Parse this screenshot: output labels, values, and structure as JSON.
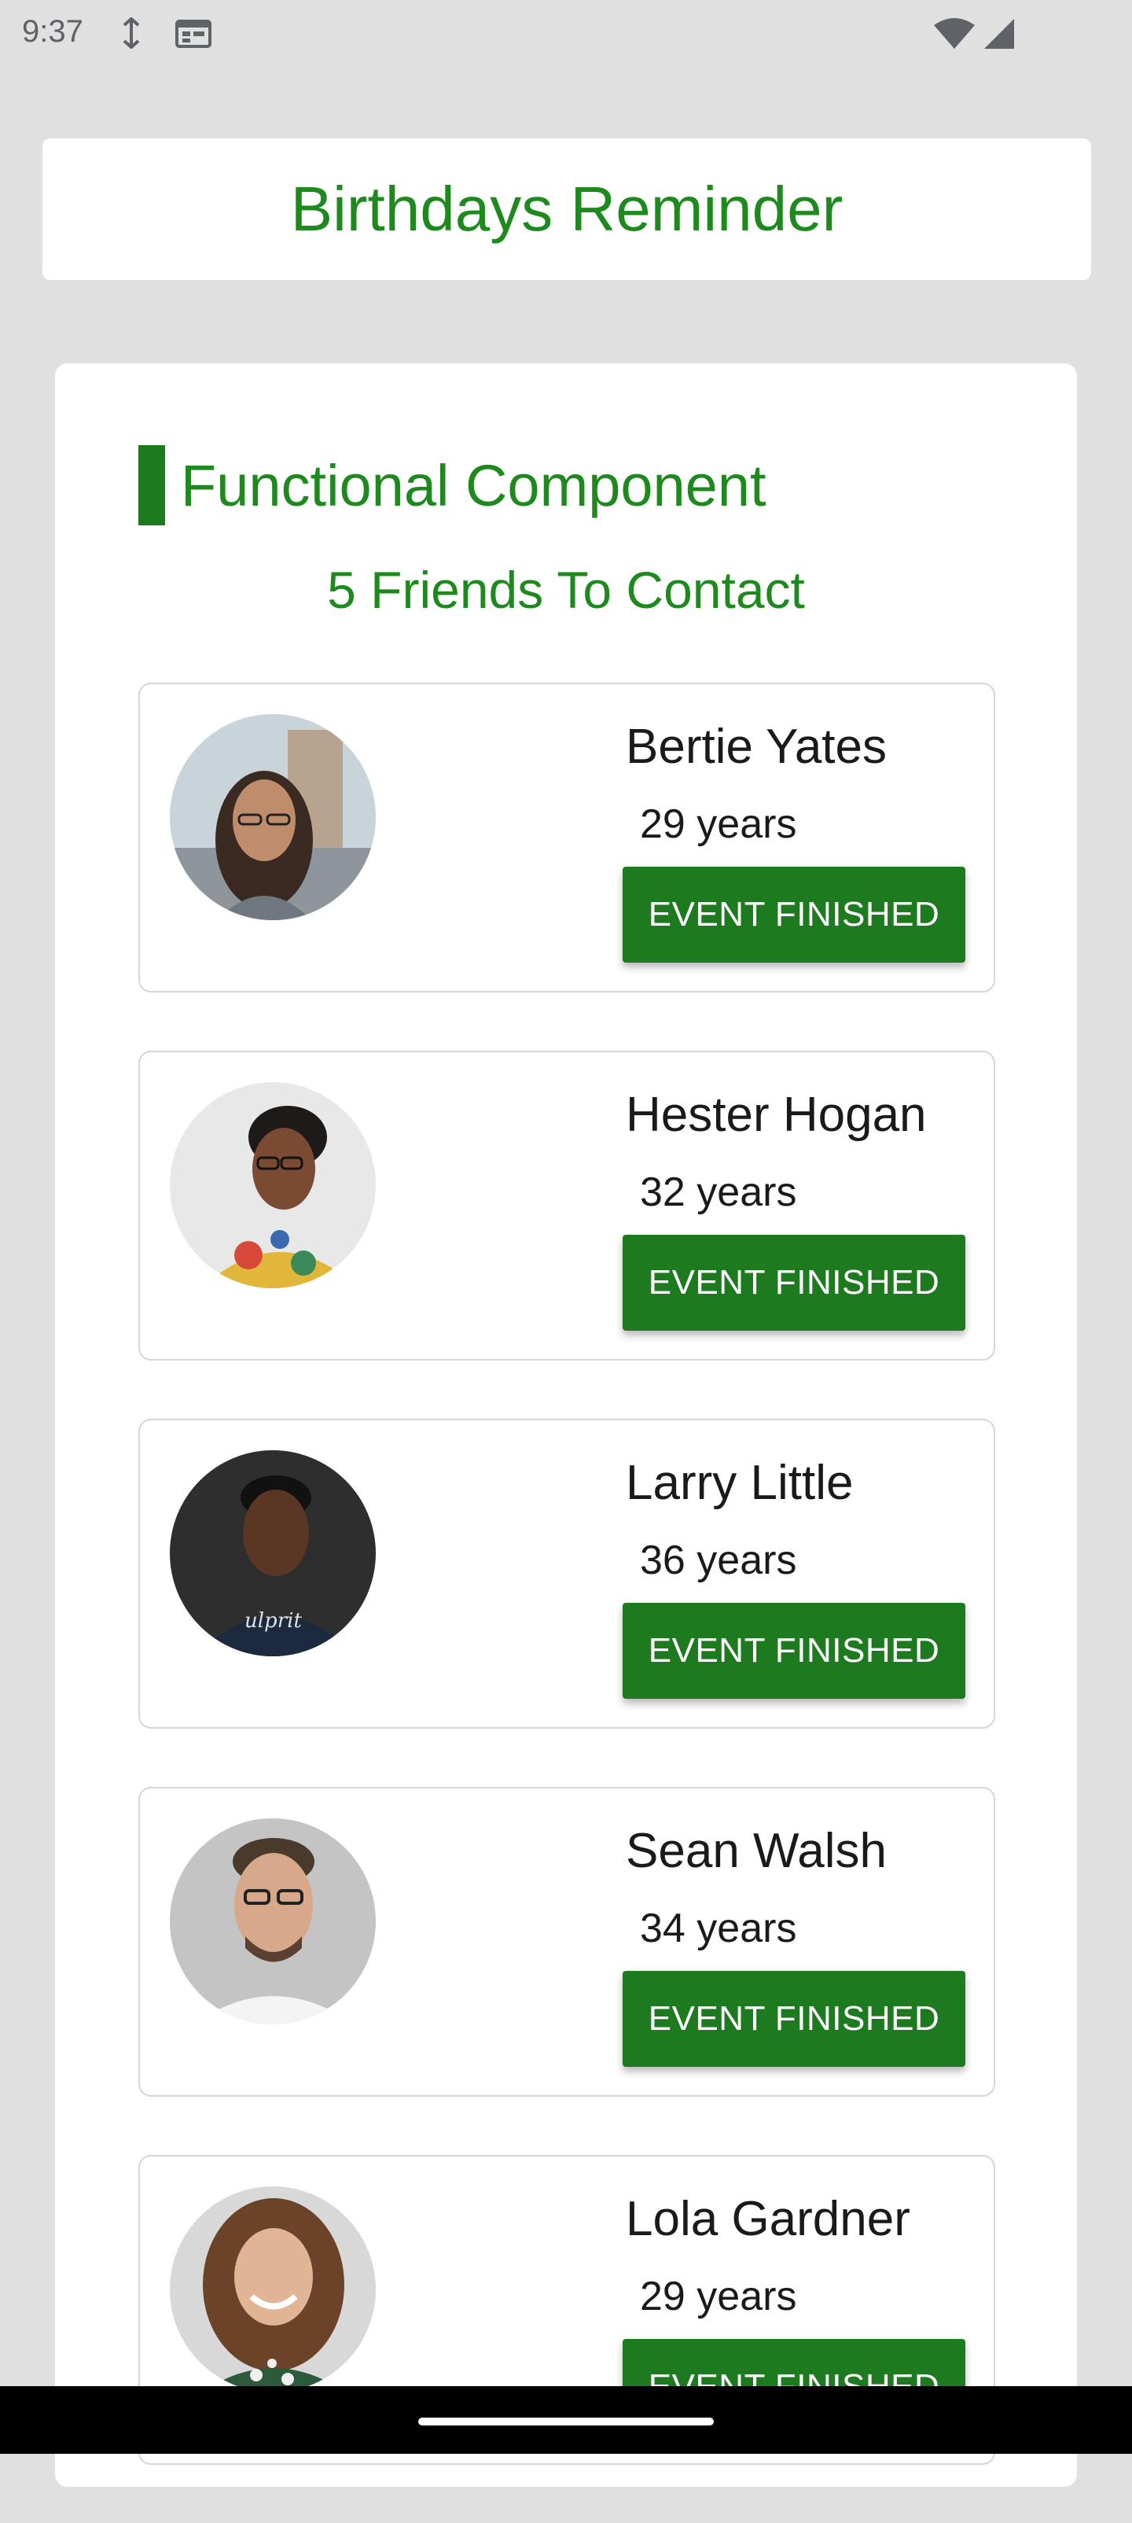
{
  "status_bar": {
    "time": "9:37",
    "icons": [
      "data-saver-icon",
      "calendar-icon",
      "wifi-icon",
      "signal-icon"
    ]
  },
  "header": {
    "title": "Birthdays Reminder"
  },
  "section": {
    "title": "Functional Component",
    "count_text": "5 Friends To Contact"
  },
  "friends": [
    {
      "name": "Bertie Yates",
      "age": "29 years",
      "button": "EVENT FINISHED"
    },
    {
      "name": "Hester Hogan",
      "age": "32 years",
      "button": "EVENT FINISHED"
    },
    {
      "name": "Larry Little",
      "age": "36 years",
      "button": "EVENT FINISHED"
    },
    {
      "name": "Sean Walsh",
      "age": "34 years",
      "button": "EVENT FINISHED"
    },
    {
      "name": "Lola Gardner",
      "age": "29 years",
      "button": "EVENT FINISHED"
    }
  ],
  "colors": {
    "accent_green": "#1e7a1e",
    "title_green": "#1e8a1e",
    "background": "#e0e0e0"
  }
}
